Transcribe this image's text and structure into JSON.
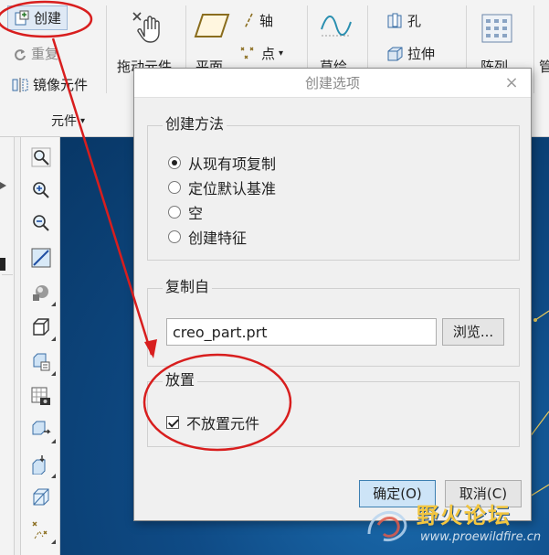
{
  "ribbon": {
    "create_label": "创建",
    "redo_label": "重复",
    "mirror_label": "镜像元件",
    "drag_label": "拖动元件",
    "plane_label": "平面",
    "axis_label": "轴",
    "point_label": "点",
    "sketch_label": "草绘",
    "hole_label": "孔",
    "extrude_label": "拉伸",
    "pattern_label": "阵列",
    "right_cut_label": "管",
    "group_components_label": "元件"
  },
  "dialog": {
    "title": "创建选项",
    "method": {
      "legend": "创建方法",
      "options": [
        "从现有项复制",
        "定位默认基准",
        "空",
        "创建特征"
      ],
      "selected_index": 0
    },
    "copy_from": {
      "legend": "复制自",
      "file_value": "creo_part.prt",
      "browse_label": "浏览..."
    },
    "placement": {
      "legend": "放置",
      "no_place_label": "不放置元件",
      "no_place_checked": true
    },
    "ok_label": "确定(O)",
    "cancel_label": "取消(C)"
  },
  "watermark": {
    "title": "野火论坛",
    "url": "www.proewildfire.cn"
  },
  "colors": {
    "annotation": "#d81e1e",
    "viewport": "#0f4b86",
    "ok_button": "#cde4f7",
    "watermark": "#f3c63f"
  }
}
